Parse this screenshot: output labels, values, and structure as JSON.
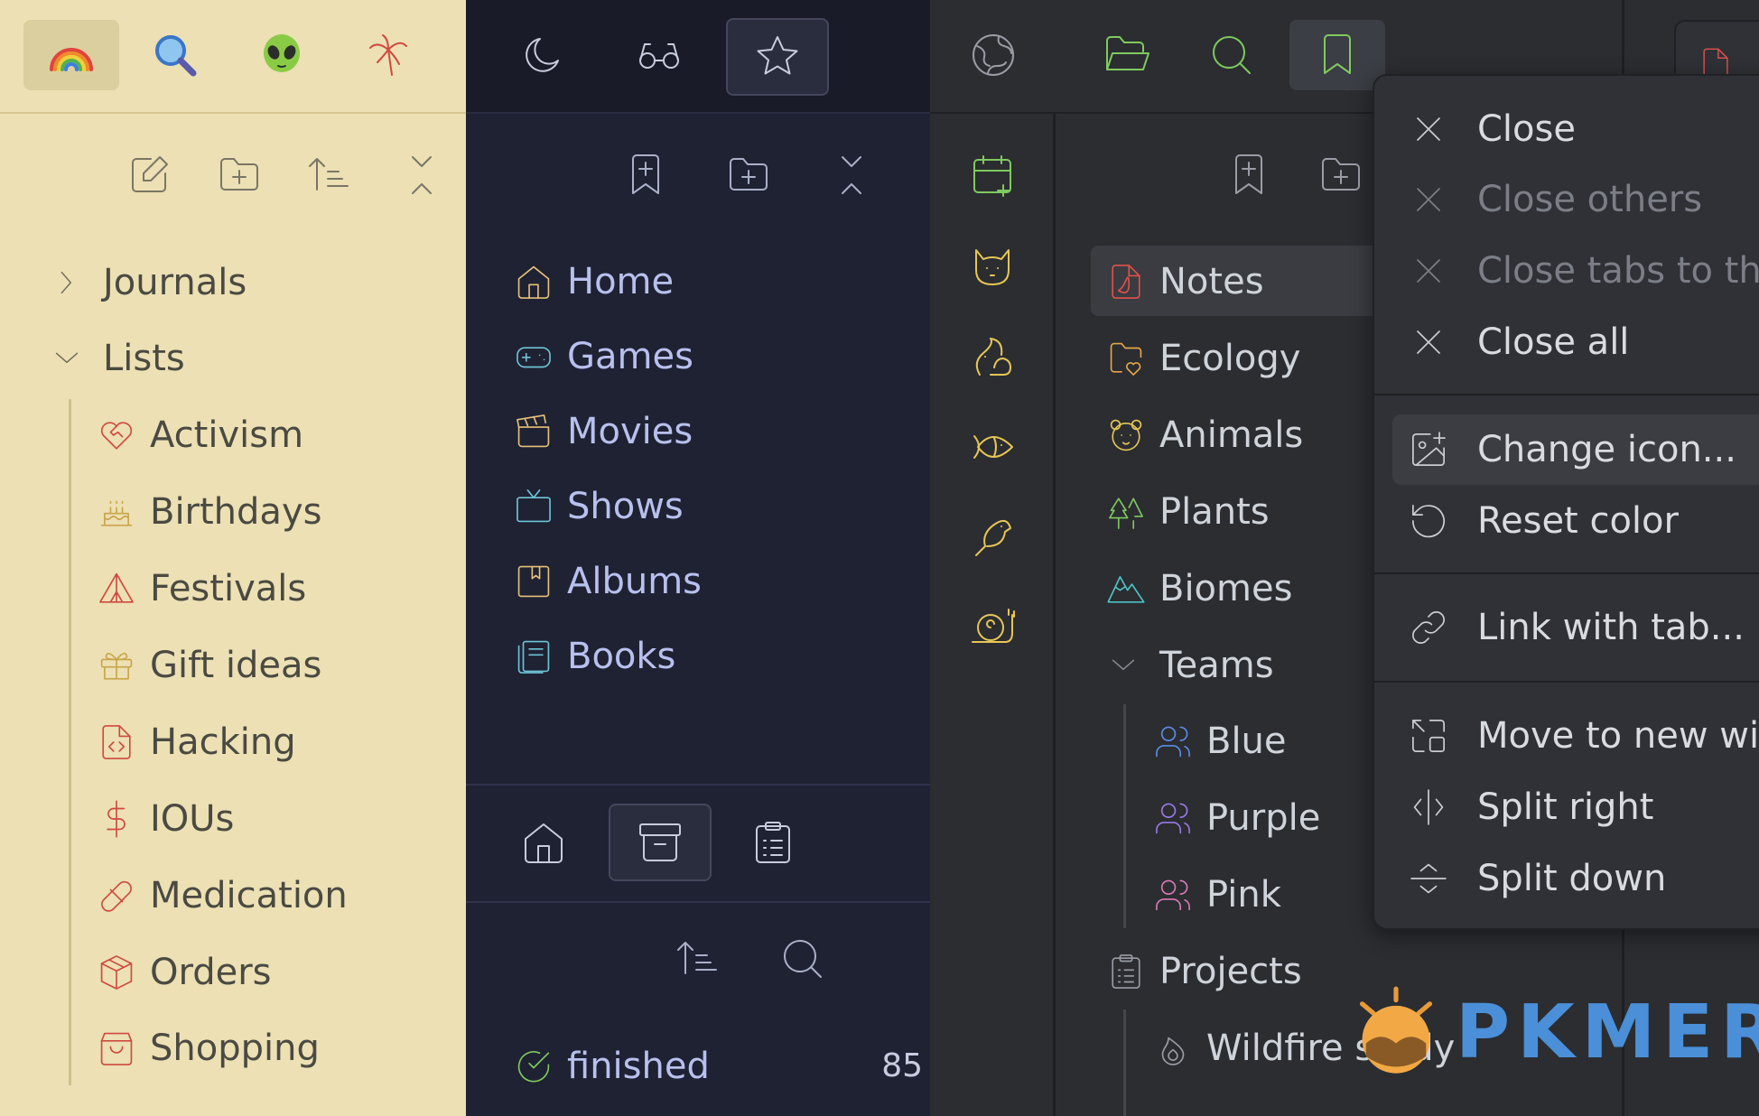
{
  "panel_yellow": {
    "tabs": [
      {
        "icon": "rainbow-icon",
        "active": true
      },
      {
        "icon": "magnifier-icon"
      },
      {
        "icon": "alien-icon"
      },
      {
        "icon": "palm-tree-icon"
      }
    ],
    "toolbar": [
      "new-note-icon",
      "new-folder-icon",
      "sort-icon",
      "collapse-icon"
    ],
    "tree": {
      "journals": "Journals",
      "lists": "Lists",
      "children": [
        "Activism",
        "Birthdays",
        "Festivals",
        "Gift ideas",
        "Hacking",
        "IOUs",
        "Medication",
        "Orders",
        "Shopping"
      ]
    },
    "colors": {
      "bg": "#ece0b4",
      "accent": "#d0493f",
      "gold": "#c9a54a"
    }
  },
  "panel_navy": {
    "tabs": [
      "moon-icon",
      "glasses-icon",
      "star-icon"
    ],
    "toolbar": [
      "bookmark-add-icon",
      "new-folder-icon",
      "collapse-icon"
    ],
    "items": [
      "Home",
      "Games",
      "Movies",
      "Shows",
      "Albums",
      "Books"
    ],
    "bottom_tabs": [
      "home-icon",
      "archive-icon",
      "clipboard-icon"
    ],
    "bottom_toolbar": [
      "sort-icon",
      "search-icon"
    ],
    "tag": {
      "label": "finished",
      "count": "85"
    },
    "colors": {
      "bg": "#1f2233",
      "text": "#b8c0ee"
    }
  },
  "panel_dark": {
    "tabs": [
      "globe-icon",
      "folder-open-icon",
      "search-icon",
      "bookmark-icon"
    ],
    "rail": [
      "calendar-plus-icon",
      "cat-icon",
      "squirrel-icon",
      "fish-icon",
      "bird-icon",
      "snail-icon"
    ],
    "items": {
      "notes": "Notes",
      "ecology": "Ecology",
      "animals": "Animals",
      "plants": "Plants",
      "biomes": "Biomes",
      "teams": "Teams",
      "blue": "Blue",
      "purple": "Purple",
      "pink": "Pink",
      "projects": "Projects",
      "wildfire": "Wildfire study"
    },
    "colors": {
      "green": "#7fca5e",
      "yellow": "#e6c655",
      "red": "#e0524b",
      "teal": "#4fc3c7",
      "blue": "#5b8ce8",
      "purple": "#9a7ae6",
      "pink": "#d97ab8"
    }
  },
  "context_menu": {
    "close": "Close",
    "close_others": "Close others",
    "close_right": "Close tabs to the",
    "close_all": "Close all",
    "change_icon": "Change icon...",
    "reset_color": "Reset color",
    "link_tab": "Link with tab...",
    "move_window": "Move to new win",
    "split_right": "Split right",
    "split_down": "Split down"
  },
  "watermark": "PKMER"
}
